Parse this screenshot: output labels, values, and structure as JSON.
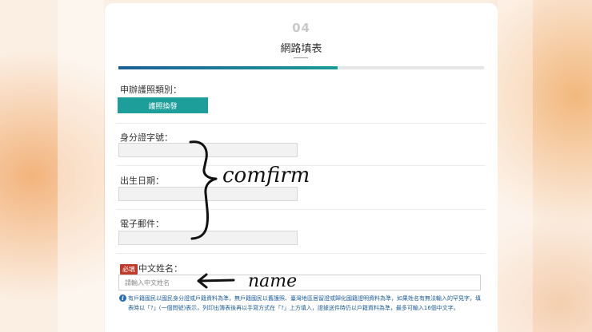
{
  "form": {
    "step_number": "04",
    "step_title": "網路填表",
    "progress_fraction": 0.6,
    "passport_type_label": "申辦護照類別：",
    "passport_type_button": "護照換發",
    "id_number_label": "身分證字號：",
    "birth_date_label": "出生日期：",
    "email_label": "電子郵件：",
    "required_badge": "必填",
    "chinese_name_label": "中文姓名：",
    "chinese_name_placeholder": "請輸入中文姓名",
    "chinese_name_note": "有戶籍國民以國民身分證或戶籍資料為準，無戶籍國民以舊護照、臺灣地區居留證或歸化國籍證明資料為準，如果姓名有無法輸入的罕見字，填表時以「?」(一個問號)表示，列印出簿表後再以手寫方式在「?」上方填入，證據送件時仍以戶籍資料為準，最多可輸入16個中文字。"
  },
  "annotations": {
    "bracket_note": "comfirm",
    "arrow_note": "name"
  },
  "colors": {
    "accent_teal": "#1e9e9a",
    "progress_start": "#1a5f98",
    "required_red": "#c0392b",
    "note_blue": "#1f5f9c"
  },
  "icons": {
    "info": "info-circle-icon"
  }
}
